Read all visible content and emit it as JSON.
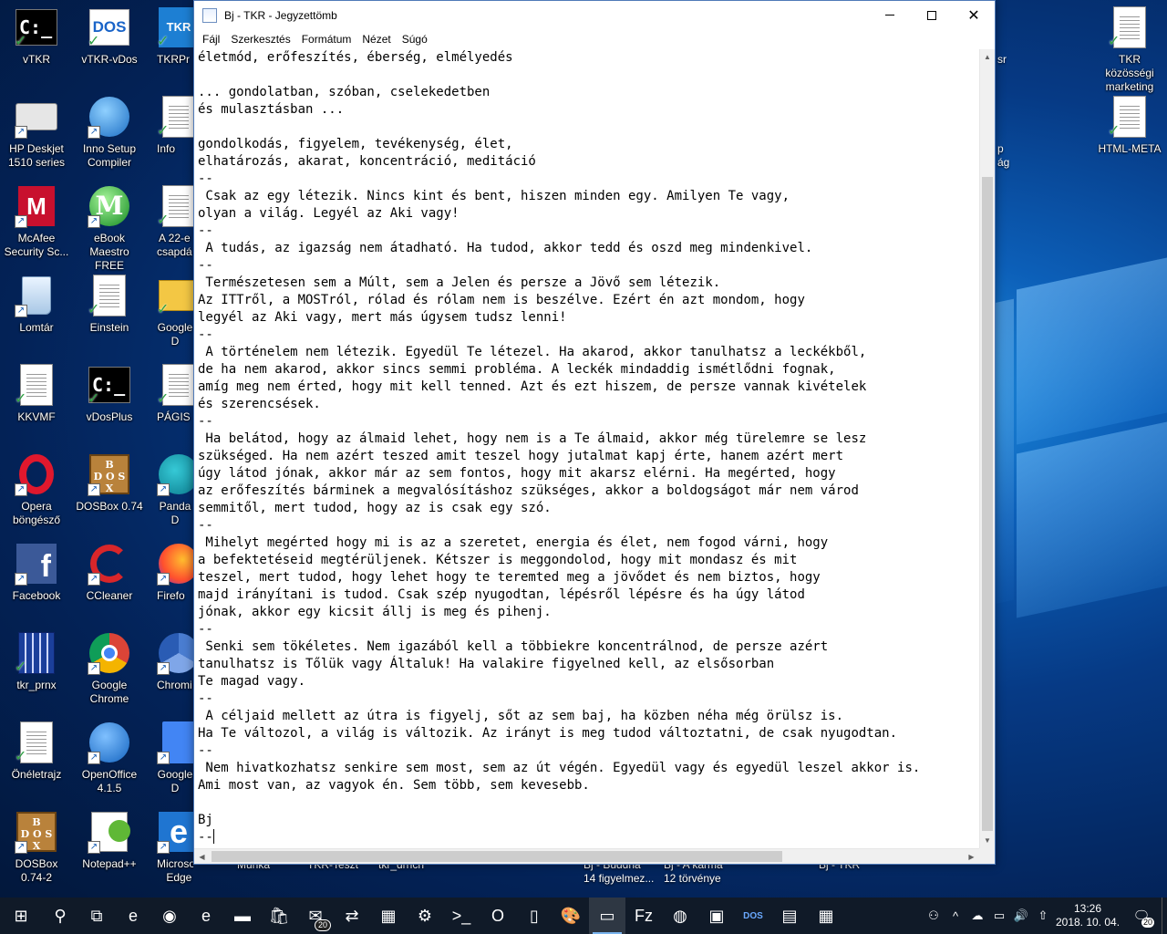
{
  "desktop": {
    "col1": [
      {
        "label": "vTKR",
        "icon": "console-icon"
      },
      {
        "label": "HP Deskjet\n1510 series",
        "icon": "printer-icon"
      },
      {
        "label": "McAfee\nSecurity Sc...",
        "icon": "mcafee-icon"
      },
      {
        "label": "Lomtár",
        "icon": "recycle-bin-icon"
      },
      {
        "label": "KKVMF",
        "icon": "document-icon"
      },
      {
        "label": "Opera\nböngésző",
        "icon": "opera-icon"
      },
      {
        "label": "Facebook",
        "icon": "facebook-icon"
      },
      {
        "label": "tkr_prnx",
        "icon": "building-icon"
      },
      {
        "label": "Önéletrajz",
        "icon": "document-icon"
      },
      {
        "label": "DOSBox\n0.74-2",
        "icon": "dosbox-icon"
      }
    ],
    "col2": [
      {
        "label": "vTKR-vDos",
        "icon": "dos-icon"
      },
      {
        "label": "Inno Setup\nCompiler",
        "icon": "inno-setup-icon"
      },
      {
        "label": "eBook\nMaestro FREE",
        "icon": "ebook-maestro-icon"
      },
      {
        "label": "Einstein",
        "icon": "document-icon"
      },
      {
        "label": "vDosPlus",
        "icon": "console-icon"
      },
      {
        "label": "DOSBox 0.74",
        "icon": "dosbox-icon"
      },
      {
        "label": "CCleaner",
        "icon": "ccleaner-icon"
      },
      {
        "label": "Google\nChrome",
        "icon": "chrome-icon"
      },
      {
        "label": "OpenOffice\n4.1.5",
        "icon": "openoffice-icon"
      },
      {
        "label": "Notepad++",
        "icon": "notepadpp-icon"
      }
    ],
    "col3": [
      {
        "label": "TKRPr",
        "icon": "tkr-icon"
      },
      {
        "label": "Info",
        "icon": "document-icon"
      },
      {
        "label": "A 22-e\ncsapdá",
        "icon": "document-icon"
      },
      {
        "label": "Google D",
        "icon": "folder-icon"
      },
      {
        "label": "PÁGIS",
        "icon": "document-icon"
      },
      {
        "label": "Panda D",
        "icon": "panda-icon"
      },
      {
        "label": "Firefo",
        "icon": "firefox-icon"
      },
      {
        "label": "Chromi",
        "icon": "chromium-icon"
      },
      {
        "label": "Google D",
        "icon": "google-docs-icon"
      },
      {
        "label": "Microsoft\nEdge",
        "icon": "edge-icon"
      }
    ],
    "right": [
      {
        "label": "TKR közösségi\nmarketing",
        "icon": "document-icon"
      },
      {
        "label": "HTML-META",
        "icon": "document-icon"
      }
    ],
    "partial_labels": [
      "Munka",
      "TKR-Teszt",
      "tkr_drncn",
      "Bj - Buddha\n14 figyelmez...",
      "Bj - A karma\n12 törvénye",
      "Bj - TKR",
      "sr",
      "p\nág"
    ]
  },
  "window": {
    "title": "Bj - TKR - Jegyzettömb",
    "minimize": "—",
    "maximize": "☐",
    "close": "✕",
    "menu": [
      "Fájl",
      "Szerkesztés",
      "Formátum",
      "Nézet",
      "Súgó"
    ]
  },
  "editor": {
    "text": "életmód, erőfeszítés, éberség, elmélyedés\n\n... gondolatban, szóban, cselekedetben\nés mulasztásban ...\n\ngondolkodás, figyelem, tevékenység, élet,\nelhatározás, akarat, koncentráció, meditáció\n--\n Csak az egy létezik. Nincs kint és bent, hiszen minden egy. Amilyen Te vagy,\nolyan a világ. Legyél az Aki vagy!\n--\n A tudás, az igazság nem átadható. Ha tudod, akkor tedd és oszd meg mindenkivel.\n--\n Természetesen sem a Múlt, sem a Jelen és persze a Jövő sem létezik.\nAz ITTről, a MOSTról, rólad és rólam nem is beszélve. Ezért én azt mondom, hogy\nlegyél az Aki vagy, mert más úgysem tudsz lenni!\n--\n A történelem nem létezik. Egyedül Te létezel. Ha akarod, akkor tanulhatsz a leckékből,\nde ha nem akarod, akkor sincs semmi probléma. A leckék mindaddig ismétlődni fognak,\namíg meg nem érted, hogy mit kell tenned. Azt és ezt hiszem, de persze vannak kivételek\nés szerencsések.\n--\n Ha belátod, hogy az álmaid lehet, hogy nem is a Te álmaid, akkor még türelemre se lesz\nszükséged. Ha nem azért teszed amit teszel hogy jutalmat kapj érte, hanem azért mert\núgy látod jónak, akkor már az sem fontos, hogy mit akarsz elérni. Ha megérted, hogy\naz erőfeszítés bárminek a megvalósításhoz szükséges, akkor a boldogságot már nem várod\nsemmitől, mert tudod, hogy az is csak egy szó.\n--\n Mihelyt megérted hogy mi is az a szeretet, energia és élet, nem fogod várni, hogy\na befektetéseid megtérüljenek. Kétszer is meggondolod, hogy mit mondasz és mit\nteszel, mert tudod, hogy lehet hogy te teremted meg a jövődet és nem biztos, hogy\nmajd irányítani is tudod. Csak szép nyugodtan, lépésről lépésre és ha úgy látod\njónak, akkor egy kicsit állj is meg és pihenj.\n--\n Senki sem tökéletes. Nem igazából kell a többiekre koncentrálnod, de persze azért\ntanulhatsz is Tőlük vagy Általuk! Ha valakire figyelned kell, az elsősorban\nTe magad vagy.\n--\n A céljaid mellett az útra is figyelj, sőt az sem baj, ha közben néha még örülsz is.\nHa Te változol, a világ is változik. Az irányt is meg tudod változtatni, de csak nyugodtan.\n--\n Nem hivatkozhatsz senkire sem most, sem az út végén. Egyedül vagy és egyedül leszel akkor is.\nAmi most van, az vagyok én. Sem több, sem kevesebb.\n\nBj\n--"
  },
  "taskbar": {
    "items": [
      {
        "name": "start-button",
        "glyph": "⊞"
      },
      {
        "name": "search-button",
        "glyph": "⚲"
      },
      {
        "name": "task-view-button",
        "glyph": "⧉"
      },
      {
        "name": "taskbar-edge",
        "glyph": "e"
      },
      {
        "name": "taskbar-chrome",
        "glyph": "◉"
      },
      {
        "name": "taskbar-ie",
        "glyph": "e"
      },
      {
        "name": "taskbar-explorer",
        "glyph": "▬"
      },
      {
        "name": "taskbar-store",
        "glyph": "🛍"
      },
      {
        "name": "taskbar-mail",
        "glyph": "✉",
        "badge": "20"
      },
      {
        "name": "taskbar-teamviewer",
        "glyph": "⇄"
      },
      {
        "name": "taskbar-network",
        "glyph": "▦"
      },
      {
        "name": "taskbar-settings",
        "glyph": "⚙"
      },
      {
        "name": "taskbar-console",
        "glyph": ">_"
      },
      {
        "name": "taskbar-opera",
        "glyph": "O"
      },
      {
        "name": "taskbar-document",
        "glyph": "▯"
      },
      {
        "name": "taskbar-paint",
        "glyph": "🎨"
      },
      {
        "name": "taskbar-notepad",
        "glyph": "▭",
        "active": true
      },
      {
        "name": "taskbar-filezilla",
        "glyph": "Fz"
      },
      {
        "name": "taskbar-firefox",
        "glyph": "◍"
      },
      {
        "name": "taskbar-dosbox",
        "glyph": "▣"
      },
      {
        "name": "taskbar-dos",
        "glyph": "DOS"
      },
      {
        "name": "taskbar-window",
        "glyph": "▤"
      },
      {
        "name": "taskbar-calculator",
        "glyph": "▦"
      }
    ],
    "tray": [
      "⚇",
      "^",
      "☁",
      "▭",
      "🔊",
      "⇧"
    ],
    "time": "13:26",
    "date": "2018. 10. 04.",
    "notifications": "20"
  },
  "colors": {
    "accent": "#4f7ab8",
    "taskbar": "#101a28"
  }
}
